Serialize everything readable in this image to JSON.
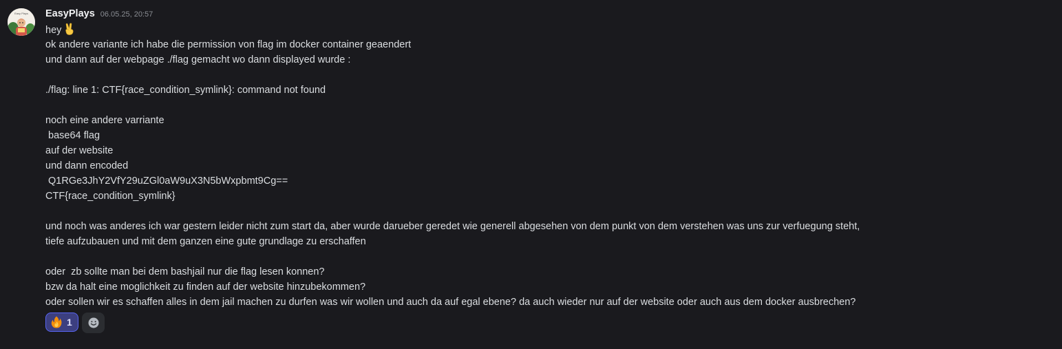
{
  "message": {
    "username": "EasyPlays",
    "avatar_text": "Easy Plays",
    "timestamp": "06.05.25, 20:57",
    "first_line_text": "hey",
    "first_line_emoji": "victory-hand-emoji",
    "lines": [
      "ok andere variante ich habe die permission von flag im docker container geaendert",
      "und dann auf der webpage ./flag gemacht wo dann displayed wurde :",
      "",
      "./flag: line 1: CTF{race_condition_symlink}: command not found",
      "",
      "noch eine andere varriante",
      " base64 flag",
      "auf der website",
      "und dann encoded",
      " Q1RGe3JhY2VfY29uZGl0aW9uX3N5bWxpbmt9Cg==",
      "CTF{race_condition_symlink}",
      "",
      "und noch was anderes ich war gestern leider nicht zum start da, aber wurde darueber geredet wie generell abgesehen von dem punkt von dem verstehen was uns zur verfuegung steht,",
      "tiefe aufzubauen und mit dem ganzen eine gute grundlage zu erschaffen",
      "",
      "oder  zb sollte man bei dem bashjail nur die flag lesen konnen?",
      "bzw da halt eine moglichkeit zu finden auf der website hinzubekommen?",
      "oder sollen wir es schaffen alles in dem jail machen zu durfen was wir wollen und auch da auf egal ebene? da auch wieder nur auf der website oder auch aus dem docker ausbrechen?"
    ]
  },
  "reactions": [
    {
      "emoji": "fire-emoji",
      "count": "1",
      "active": true
    }
  ],
  "add_reaction_icon": "smiley-add-reaction-icon",
  "colors": {
    "background": "#1a1a1e",
    "text": "#dbdee1",
    "username": "#f2f3f5",
    "timestamp": "#8a8d93",
    "reaction_active_bg": "#3c3f80",
    "reaction_active_border": "#5865f2"
  }
}
